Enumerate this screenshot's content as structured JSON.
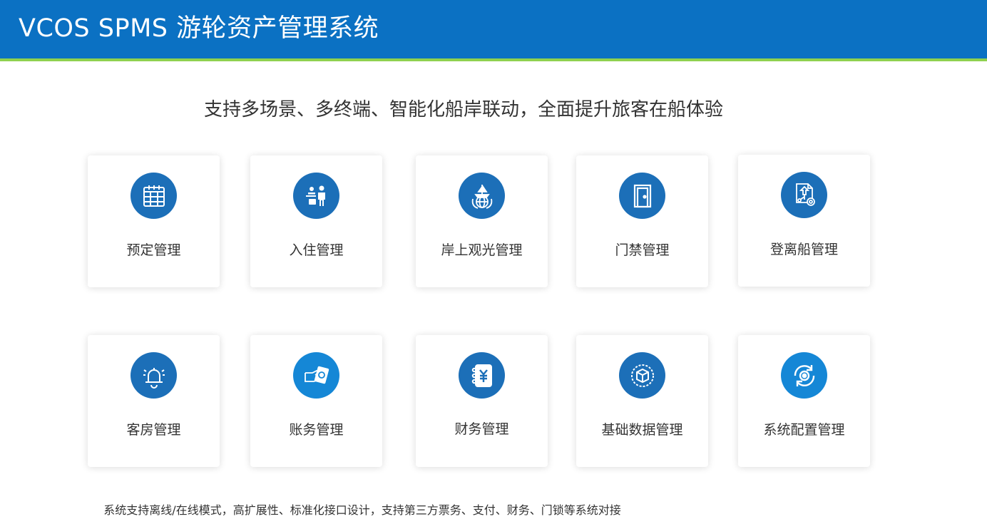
{
  "header": {
    "title": "VCOS SPMS 游轮资产管理系统"
  },
  "subtitle": "支持多场景、多终端、智能化船岸联动，全面提升旅客在船体验",
  "modules": [
    {
      "label": "预定管理",
      "icon": "calendar-icon",
      "color": "#1c6fb8"
    },
    {
      "label": "入住管理",
      "icon": "checkin-icon",
      "color": "#1c6fb8"
    },
    {
      "label": "岸上观光管理",
      "icon": "globe-ship-icon",
      "color": "#1c6fb8"
    },
    {
      "label": "门禁管理",
      "icon": "door-icon",
      "color": "#1c6fb8"
    },
    {
      "label": "登离船管理",
      "icon": "boarding-document-icon",
      "color": "#1c6fb8"
    },
    {
      "label": "客房管理",
      "icon": "bell-icon",
      "color": "#1c6fb8"
    },
    {
      "label": "账务管理",
      "icon": "payment-card-icon",
      "color": "#1587d6"
    },
    {
      "label": "财务管理",
      "icon": "yuan-notebook-icon",
      "color": "#1c6fb8"
    },
    {
      "label": "基础数据管理",
      "icon": "data-box-icon",
      "color": "#1c6fb8"
    },
    {
      "label": "系统配置管理",
      "icon": "config-gear-icon",
      "color": "#1587d6"
    }
  ],
  "footer": "系统支持离线/在线模式，高扩展性、标准化接口设计，支持第三方票务、支付、财务、门锁等系统对接"
}
